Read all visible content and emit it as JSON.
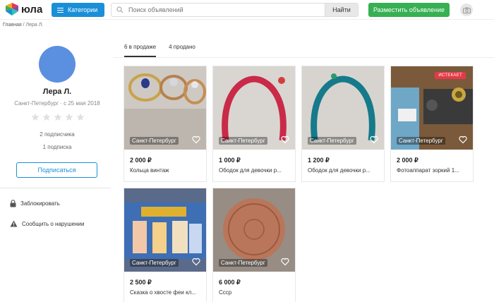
{
  "header": {
    "logo_text": "юла",
    "categories_label": "Категории",
    "search_placeholder": "Поиск объявлений",
    "search_button": "Найти",
    "post_button": "Разместить объявление"
  },
  "breadcrumb": {
    "home": "Главная",
    "separator": "/",
    "current": "Лера Л."
  },
  "profile": {
    "name": "Лера Л.",
    "location": "Санкт-Петербург · с 25 мая 2018",
    "followers": "2 подписчика",
    "following": "1 подписка",
    "subscribe_button": "Подписаться",
    "block_label": "Заблокировать",
    "report_label": "Сообщить о нарушении",
    "avatar_color": "#5b8fe0"
  },
  "tabs": [
    {
      "label": "6 в продаже",
      "active": true
    },
    {
      "label": "4 продано",
      "active": false
    }
  ],
  "listings": [
    {
      "price": "2 000 ₽",
      "title": "Кольца винтаж",
      "city": "Санкт-Петербург"
    },
    {
      "price": "1 000 ₽",
      "title": "Ободок для девочки р...",
      "city": "Санкт-Петербург"
    },
    {
      "price": "1 200 ₽",
      "title": "Ободок для девочки р...",
      "city": "Санкт-Петербург"
    },
    {
      "price": "2 000 ₽",
      "title": "Фотоаппарат зоркий 1...",
      "city": "Санкт-Петербург",
      "badge": "ИСТЕКАЕТ"
    },
    {
      "price": "2 500 ₽",
      "title": "Сказка о хвосте феи кл...",
      "city": "Санкт-Петербург"
    },
    {
      "price": "6 000 ₽",
      "title": "Ссср",
      "city": "Санкт-Петербург"
    }
  ],
  "colors": {
    "accent_blue": "#1a8fd8",
    "post_green": "#36b052",
    "badge_red": "#e53946"
  }
}
